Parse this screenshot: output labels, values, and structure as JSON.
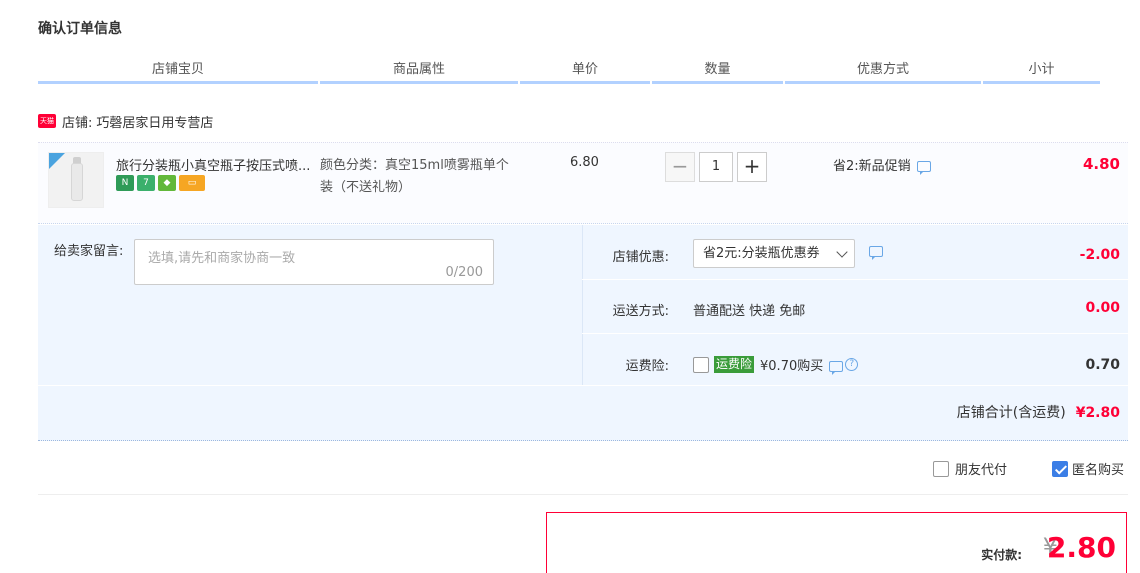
{
  "page_title": "确认订单信息",
  "columns": [
    "店铺宝贝",
    "商品属性",
    "单价",
    "数量",
    "优惠方式",
    "小计"
  ],
  "shop": {
    "badge": "天猫",
    "label": "店铺:",
    "name": "巧磬居家日用专营店"
  },
  "item": {
    "title": "旅行分装瓶小真空瓶子按压式喷...",
    "service_icons": [
      "new-icon",
      "7-day-return-icon",
      "tmall-guarantee-icon",
      "card-payment-icon"
    ],
    "attribute": "颜色分类：真空15ml喷雾瓶单个装（不送礼物）",
    "price": "6.80",
    "quantity": "1",
    "promo": "省2:新品促销",
    "subtotal": "4.80"
  },
  "message": {
    "label": "给卖家留言:",
    "placeholder": "选填,请先和商家协商一致",
    "count": "0/200"
  },
  "options": {
    "coupon_label": "店铺优惠:",
    "coupon_value": "省2元:分装瓶优惠券",
    "coupon_amount": "-2.00",
    "shipping_label": "运送方式:",
    "shipping_value": "普通配送 快递 免邮",
    "shipping_amount": "0.00",
    "insurance_label": "运费险:",
    "insurance_badge": "运费险",
    "insurance_text": "¥0.70购买",
    "insurance_amount": "0.70"
  },
  "shop_total": {
    "label": "店铺合计(含运费)",
    "value": "¥2.80"
  },
  "checkboxes": {
    "friend_pay": "朋友代付",
    "anonymous": "匿名购买"
  },
  "payment": {
    "label": "实付款:",
    "currency": "¥",
    "amount": "2.80"
  },
  "colors": {
    "accent_red": "#ff0036",
    "header_underline": "#b2d1ff",
    "panel_bg": "#eff6ff",
    "checkbox_blue": "#3b7ee6"
  }
}
